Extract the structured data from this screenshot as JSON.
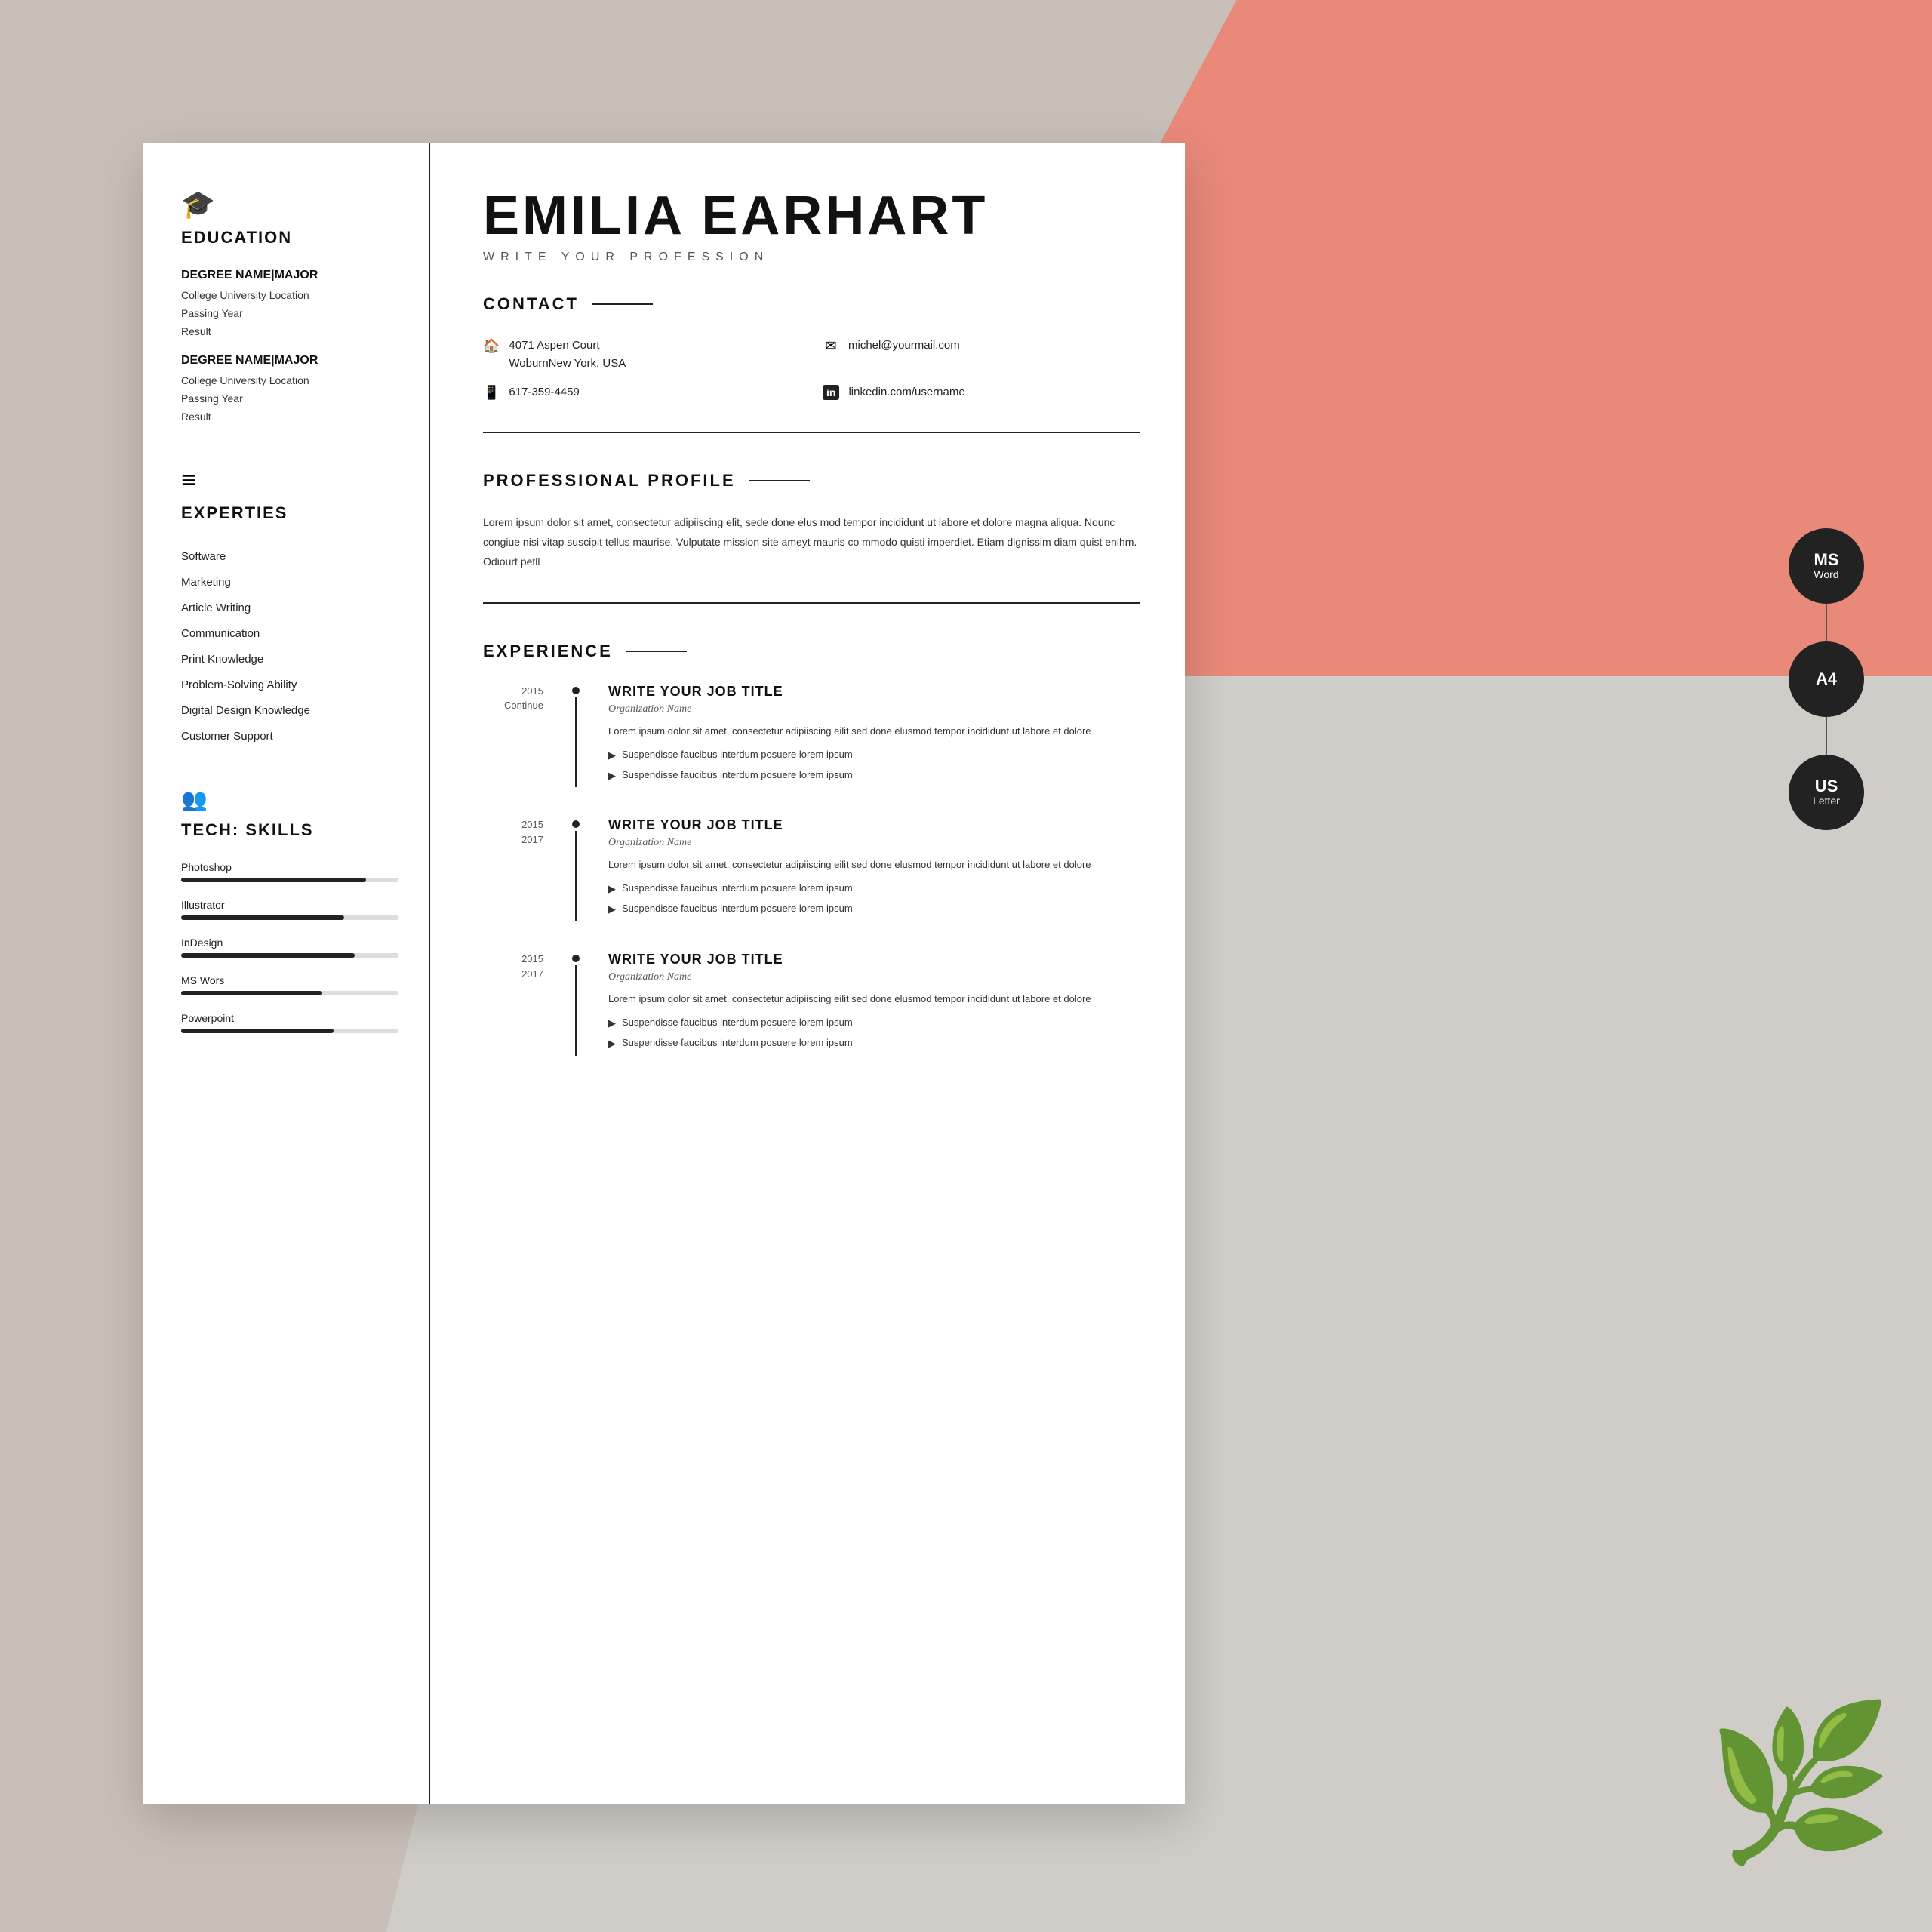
{
  "background": {
    "pink_color": "#e8897a",
    "gray_color": "#d0ccc8"
  },
  "resume": {
    "name": "EMILIA EARHART",
    "profession": "WRITE YOUR PROFESSION",
    "contact": {
      "section_title": "CONTACT",
      "address_icon": "🏠",
      "address_line1": "4071 Aspen Court",
      "address_line2": "WoburnNew York, USA",
      "email_icon": "✉",
      "email": "michel@yourmail.com",
      "phone_icon": "📱",
      "phone": "617-359-4459",
      "linkedin_icon": "in",
      "linkedin": "linkedin.com/username"
    },
    "profile": {
      "section_title": "PROFESSIONAL PROFILE",
      "text": "Lorem ipsum dolor sit amet, consectetur adipiiscing elit, sede done elus mod tempor incididunt ut labore et dolore magna aliqua. Nounc congiue nisi vitap suscipit tellus maurise. Vulputate mission site ameyt mauris co mmodo quisti imperdiet. Etiam dignissim diam quist enihm. Odiourt petll"
    },
    "experience": {
      "section_title": "EXPERIENCE",
      "entries": [
        {
          "year_start": "2015",
          "year_end": "Continue",
          "job_title": "WRITE YOUR JOB TITLE",
          "org": "Organization Name",
          "description": "Lorem ipsum dolor sit amet, consectetur adipiiscing eilit sed done elusmod tempor incididunt ut labore et dolore",
          "bullets": [
            "Suspendisse faucibus interdum posuere lorem ipsum",
            "Suspendisse faucibus interdum posuere lorem ipsum"
          ]
        },
        {
          "year_start": "2015",
          "year_end": "2017",
          "job_title": "WRITE YOUR JOB TITLE",
          "org": "Organization Name",
          "description": "Lorem ipsum dolor sit amet, consectetur adipiiscing eilit sed done elusmod tempor incididunt ut labore et dolore",
          "bullets": [
            "Suspendisse faucibus interdum posuere lorem ipsum",
            "Suspendisse faucibus interdum posuere lorem ipsum"
          ]
        },
        {
          "year_start": "2015",
          "year_end": "2017",
          "job_title": "WRITE YOUR JOB TITLE",
          "org": "Organization Name",
          "description": "Lorem ipsum dolor sit amet, consectetur adipiiscing eilit sed done elusmod tempor incididunt ut labore et dolore",
          "bullets": [
            "Suspendisse faucibus interdum posuere lorem ipsum",
            "Suspendisse faucibus interdum posuere lorem ipsum"
          ]
        }
      ]
    }
  },
  "sidebar": {
    "education": {
      "section_title": "EDUCATION",
      "icon": "🎓",
      "degrees": [
        {
          "name": "DEGREE NAME|MAJOR",
          "university": "College University Location",
          "year": "Passing Year",
          "result": "Result"
        },
        {
          "name": "DEGREE NAME|MAJOR",
          "university": "College University Location",
          "year": "Passing Year",
          "result": "Result"
        }
      ]
    },
    "expertise": {
      "section_title": "EXPERTIES",
      "icon": "📚",
      "items": [
        "Software",
        "Marketing",
        "Article Writing",
        "Communication",
        "Print Knowledge",
        "Problem-Solving Ability",
        "Digital Design Knowledge",
        "Customer Support"
      ]
    },
    "tech_skills": {
      "section_title": "TECH: SKILLS",
      "icon": "👥",
      "skills": [
        {
          "name": "Photoshop",
          "percent": 85
        },
        {
          "name": "Illustrator",
          "percent": 75
        },
        {
          "name": "InDesign",
          "percent": 80
        },
        {
          "name": "MS Wors",
          "percent": 65
        },
        {
          "name": "Powerpoint",
          "percent": 70
        }
      ]
    }
  },
  "format_badges": [
    {
      "main": "MS",
      "sub": "Word"
    },
    {
      "main": "A4",
      "sub": ""
    },
    {
      "main": "US",
      "sub": "Letter"
    }
  ]
}
